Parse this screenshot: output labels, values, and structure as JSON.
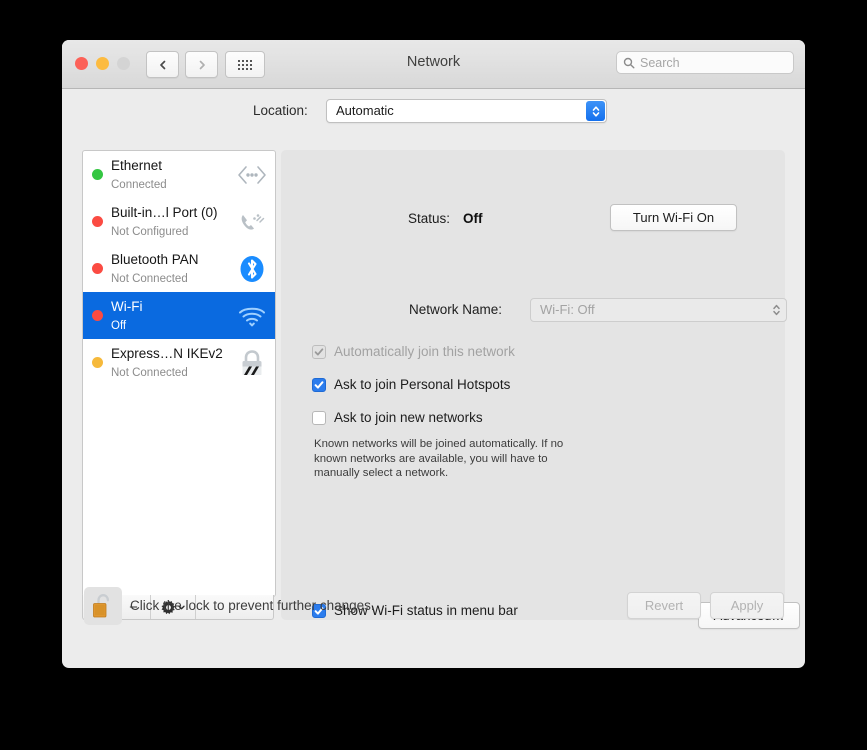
{
  "window": {
    "title": "Network",
    "traffic": {
      "close": "close-button",
      "minimize": "minimize-button",
      "zoom": "zoom-button"
    },
    "search": {
      "placeholder": "Search"
    }
  },
  "location": {
    "label": "Location:",
    "value": "Automatic"
  },
  "sidebar": {
    "services": [
      {
        "name": "Ethernet",
        "status": "Connected",
        "dot": "#34c642",
        "icon": "ethernet-icon"
      },
      {
        "name": "Built-in…l Port (0)",
        "status": "Not Configured",
        "dot": "#fb4b42",
        "icon": "modem-icon"
      },
      {
        "name": "Bluetooth PAN",
        "status": "Not Connected",
        "dot": "#fb4b42",
        "icon": "bluetooth-icon"
      },
      {
        "name": "Wi-Fi",
        "status": "Off",
        "dot": "#fb4b42",
        "icon": "wifi-icon",
        "selected": true
      },
      {
        "name": "Express…N IKEv2",
        "status": "Not Connected",
        "dot": "#f6b93b",
        "icon": "vpn-lock-icon"
      }
    ],
    "toolbar": {
      "add": "+",
      "remove": "−",
      "action": "gear-icon"
    }
  },
  "main": {
    "status_label": "Status:",
    "status_value": "Off",
    "turn_on_button": "Turn Wi-Fi On",
    "network_name_label": "Network Name:",
    "network_name_value": "Wi-Fi: Off",
    "checkboxes": [
      {
        "label": "Automatically join this network",
        "state": "checked-disabled"
      },
      {
        "label": "Ask to join Personal Hotspots",
        "state": "checked"
      },
      {
        "label": "Ask to join new networks",
        "state": "unchecked"
      }
    ],
    "help_text": "Known networks will be joined automatically. If no known networks are available, you will have to manually select a network.",
    "show_menu_bar": {
      "label": "Show Wi-Fi status in menu bar",
      "state": "checked"
    },
    "advanced_button": "Advanced…",
    "help_button": "?"
  },
  "bottom": {
    "lock_icon": "unlocked-padlock-icon",
    "lock_text": "Click the lock to prevent further changes.",
    "revert_button": "Revert",
    "apply_button": "Apply"
  },
  "colors": {
    "selection_blue": "#0a6ae0",
    "accent_blue": "#2b7ced",
    "window_bg": "#ececec",
    "panel_bg": "#e4e4e4"
  }
}
